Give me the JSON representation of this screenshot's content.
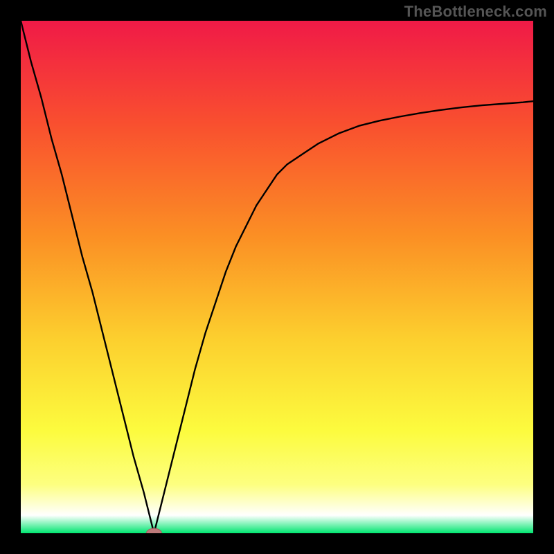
{
  "watermark": "TheBottleneck.com",
  "colors": {
    "frame": "#000000",
    "curve": "#000000",
    "marker_fill": "#bd7a7a",
    "marker_stroke": "#a55f5f",
    "gradient_stops": [
      {
        "offset": 0.0,
        "color": "#f01a47"
      },
      {
        "offset": 0.2,
        "color": "#f94f2f"
      },
      {
        "offset": 0.42,
        "color": "#fb8f24"
      },
      {
        "offset": 0.62,
        "color": "#fccf2e"
      },
      {
        "offset": 0.8,
        "color": "#fcfb3e"
      },
      {
        "offset": 0.905,
        "color": "#fdff80"
      },
      {
        "offset": 0.965,
        "color": "#ffffff"
      },
      {
        "offset": 1.0,
        "color": "#00e670"
      }
    ]
  },
  "chart_data": {
    "type": "line",
    "title": "",
    "xlabel": "",
    "ylabel": "",
    "xlim": [
      0,
      100
    ],
    "ylim": [
      0,
      100
    ],
    "x_min_at": 26,
    "series": [
      {
        "name": "curve",
        "x": [
          0,
          2,
          4,
          6,
          8,
          10,
          12,
          14,
          16,
          18,
          20,
          22,
          24,
          25,
          26,
          27,
          28,
          30,
          32,
          34,
          36,
          38,
          40,
          42,
          44,
          46,
          48,
          50,
          52,
          55,
          58,
          62,
          66,
          70,
          74,
          78,
          82,
          86,
          90,
          94,
          98,
          100
        ],
        "y": [
          100,
          92,
          85,
          77,
          70,
          62,
          54,
          47,
          39,
          31,
          23,
          15,
          8,
          4,
          0,
          4,
          8,
          16,
          24,
          32,
          39,
          45,
          51,
          56,
          60,
          64,
          67,
          70,
          72,
          74,
          76,
          78,
          79.5,
          80.5,
          81.3,
          82,
          82.6,
          83.1,
          83.5,
          83.8,
          84.1,
          84.3
        ]
      }
    ],
    "marker": {
      "x": 26,
      "y": 0
    }
  }
}
